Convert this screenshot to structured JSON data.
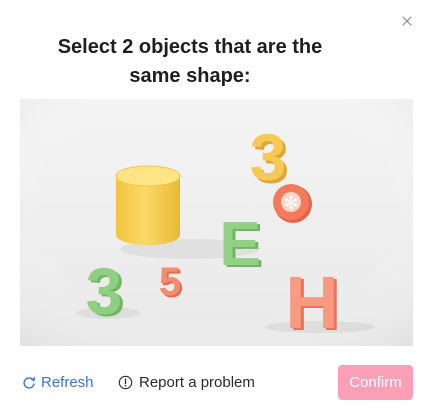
{
  "prompt": {
    "line1": "Select 2 objects that are the",
    "line2": "same shape:"
  },
  "close": {
    "icon": "close-icon"
  },
  "challenge_image": {
    "objects": [
      {
        "name": "cylinder",
        "color": "#f9d35f"
      },
      {
        "name": "digit",
        "label": "3",
        "color": "#f5c24e"
      },
      {
        "name": "flower-disc",
        "color": "#f47a5c"
      },
      {
        "name": "letter",
        "label": "E",
        "color": "#8fcf83"
      },
      {
        "name": "digit",
        "label": "3",
        "color": "#8fcf83"
      },
      {
        "name": "digit",
        "label": "5",
        "color": "#f3896e"
      },
      {
        "name": "letter",
        "label": "H",
        "color": "#f48d75"
      }
    ]
  },
  "footer": {
    "refresh_label": "Refresh",
    "refresh_icon": "refresh-icon",
    "report_label": "Report a problem",
    "report_icon": "info-icon",
    "confirm_label": "Confirm"
  },
  "colors": {
    "link": "#3b73d6",
    "confirm_bg": "#f9a0b7",
    "image_bg": "#efefef"
  }
}
